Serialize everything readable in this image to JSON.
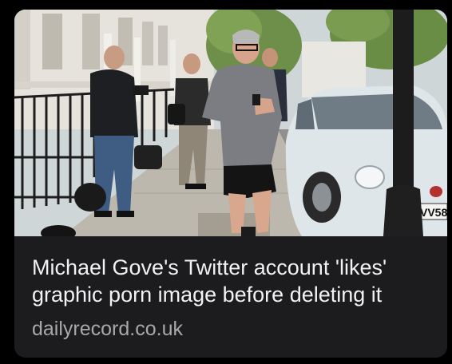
{
  "card": {
    "headline": "Michael Gove's Twitter account 'likes' graphic porn image before deleting it",
    "source": "dailyrecord.co.uk",
    "image": {
      "license_plate_text": "VV58"
    }
  },
  "colors": {
    "page_background": "#000000",
    "card_background": "#1c1c1e",
    "headline_text": "#f2f2f2",
    "source_text": "#a8a8a8"
  }
}
